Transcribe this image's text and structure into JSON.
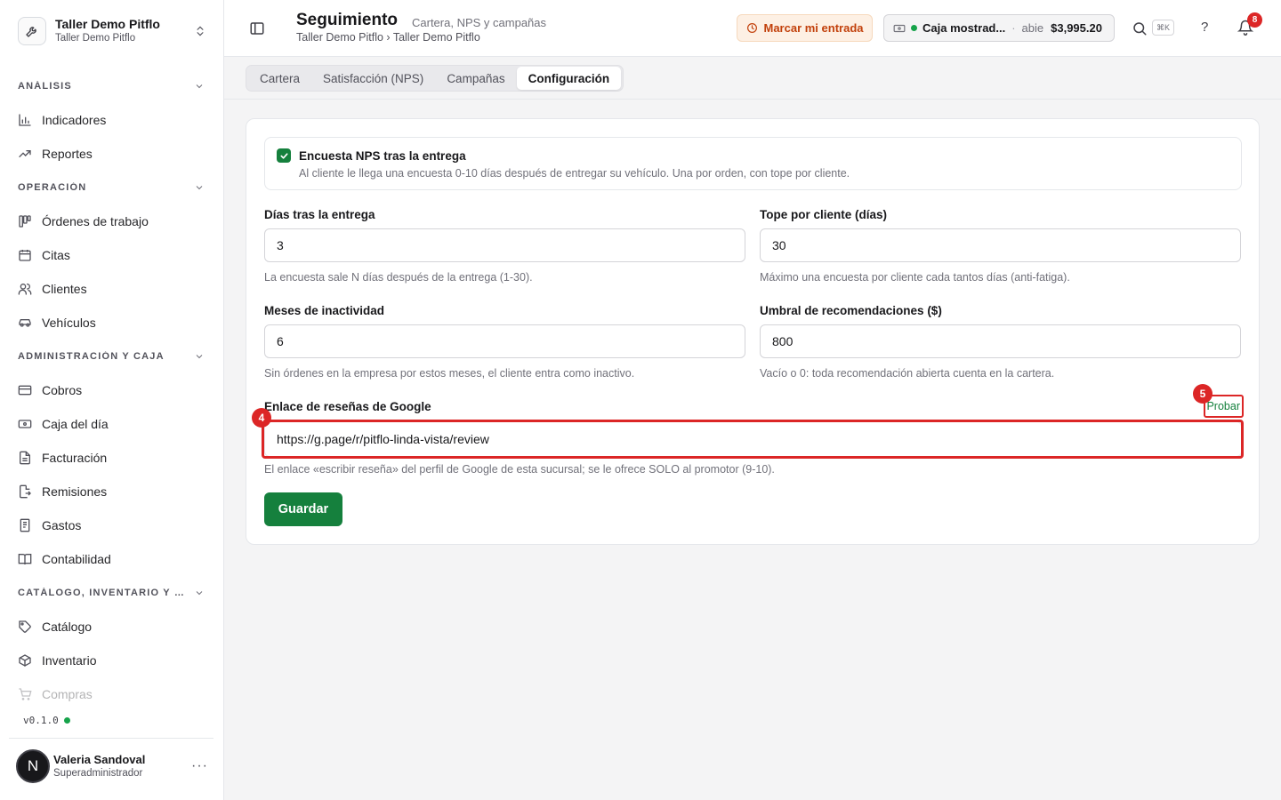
{
  "org": {
    "name": "Taller Demo Pitflo",
    "subtitle": "Taller Demo Pitflo"
  },
  "sidebar": {
    "sections": [
      {
        "title": "ANÁLISIS",
        "items": [
          "Indicadores",
          "Reportes"
        ]
      },
      {
        "title": "OPERACIÓN",
        "items": [
          "Órdenes de trabajo",
          "Citas",
          "Clientes",
          "Vehículos"
        ]
      },
      {
        "title": "ADMINISTRACIÓN Y CAJA",
        "items": [
          "Cobros",
          "Caja del día",
          "Facturación",
          "Remisiones",
          "Gastos",
          "Contabilidad"
        ]
      },
      {
        "title": "CATÁLOGO, INVENTARIO Y CO...",
        "items": [
          "Catálogo",
          "Inventario",
          "Compras"
        ]
      }
    ],
    "version": "v0.1.0"
  },
  "user": {
    "initial": "N",
    "name": "Valeria Sandoval",
    "role": "Superadministrador"
  },
  "header": {
    "title": "Seguimiento",
    "subtitle": "Cartera, NPS y campañas",
    "breadcrumb": "Taller Demo Pitflo › Taller Demo Pitflo",
    "entry_button": "Marcar mi entrada",
    "register_name": "Caja mostrad...",
    "register_state": "abie",
    "register_amount": "$3,995.20",
    "shortcut": "⌘K",
    "help": "?",
    "notifications": "8"
  },
  "tabs": [
    "Cartera",
    "Satisfacción (NPS)",
    "Campañas",
    "Configuración"
  ],
  "form": {
    "nps_title": "Encuesta NPS tras la entrega",
    "nps_desc": "Al cliente le llega una encuesta 0-10 días después de entregar su vehículo. Una por orden, con tope por cliente.",
    "days_label": "Días tras la entrega",
    "days_value": "3",
    "days_hint": "La encuesta sale N días después de la entrega (1-30).",
    "cap_label": "Tope por cliente (días)",
    "cap_value": "30",
    "cap_hint": "Máximo una encuesta por cliente cada tantos días (anti-fatiga).",
    "inactive_label": "Meses de inactividad",
    "inactive_value": "6",
    "inactive_hint": "Sin órdenes en la empresa por estos meses, el cliente entra como inactivo.",
    "threshold_label": "Umbral de recomendaciones ($)",
    "threshold_value": "800",
    "threshold_hint": "Vacío o 0: toda recomendación abierta cuenta en la cartera.",
    "google_label": "Enlace de reseñas de Google",
    "google_value": "https://g.page/r/pitflo-linda-vista/review",
    "google_hint": "El enlace «escribir reseña» del perfil de Google de esta sucursal; se le ofrece SOLO al promotor (9-10).",
    "test_label": "Probar",
    "save_label": "Guardar"
  },
  "markers": {
    "input": "4",
    "test": "5"
  },
  "colors": {
    "accent": "#15803d",
    "highlight": "#dc2626",
    "entry": "#c2410c"
  }
}
